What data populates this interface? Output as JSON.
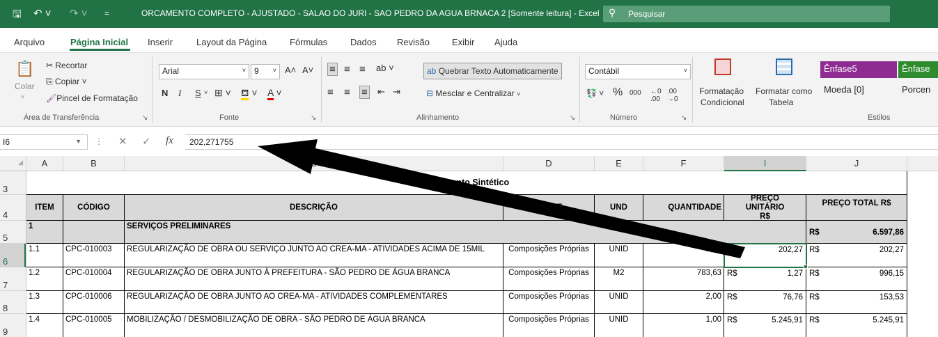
{
  "title_bar": {
    "title": "ORCAMENTO COMPLETO - AJUSTADO - SALAO DO JURI - SAO PEDRO DA AGUA BRNACA  2  [Somente leitura]  -  Excel",
    "search_label": "Pesquisar",
    "save_icon": "save-icon",
    "undo_icon": "undo-icon",
    "redo_icon": "redo-icon",
    "accent_color": "#217346"
  },
  "menu": {
    "items": [
      "Arquivo",
      "Página Inicial",
      "Inserir",
      "Layout da Página",
      "Fórmulas",
      "Dados",
      "Revisão",
      "Exibir",
      "Ajuda"
    ],
    "active": "Página Inicial"
  },
  "ribbon": {
    "clipboard": {
      "paste": "Colar",
      "cut": "Recortar",
      "copy": "Copiar",
      "format_painter": "Pincel de Formatação",
      "label": "Área de Transferência"
    },
    "font": {
      "name": "Arial",
      "size": "9",
      "bold": "N",
      "italic": "I",
      "underline": "S",
      "label": "Fonte"
    },
    "alignment": {
      "wrap_text": "Quebrar Texto Automaticamente",
      "merge_center": "Mesclar e Centralizar",
      "label": "Alinhamento"
    },
    "number": {
      "format": "Contábil",
      "percent": "%",
      "thousands": "000",
      "label": "Número"
    },
    "styles": {
      "conditional": [
        "Formatação",
        "Condicional"
      ],
      "format_table": [
        "Formatar como",
        "Tabela"
      ],
      "cell_styles": [
        "Ênfase5",
        "Ênfase",
        "Moeda [0]",
        "Porcen"
      ],
      "label": "Estilos",
      "emphasis5_color": "#8e2c91",
      "emphasis6_color": "#2e8b2e"
    }
  },
  "formula_bar": {
    "name_box": "I6",
    "fx": "fx",
    "value": "202,271755"
  },
  "columns": [
    "A",
    "B",
    "C",
    "D",
    "E",
    "F",
    "I",
    "J"
  ],
  "selected_column": "I",
  "rows": [
    "3",
    "4",
    "5",
    "6",
    "7",
    "8",
    "9"
  ],
  "selected_row": "6",
  "sheet": {
    "title": "Orçamento Sintético",
    "headers": {
      "item": "ITEM",
      "code": "CÓDIGO",
      "description": "DESCRIÇÃO",
      "source": "FONTE",
      "unit": "UND",
      "quantity": "QUANTIDADE",
      "unit_price": "PREÇO UNITÁRIO R$",
      "total_price": "PREÇO TOTAL R$"
    },
    "section": {
      "item": "1",
      "description": "SERVIÇOS PRELIMINARES",
      "currency": "R$",
      "total": "6.597,86"
    },
    "items": [
      {
        "item": "1.1",
        "code": "CPC-010003",
        "description": "REGULARIZAÇÃO  DE  OBRA  OU  SERVIÇO  JUNTO  AO  CREA-MA  -  ATIVIDADES ACIMA DE 15MIL",
        "source": "Composições Próprias",
        "unit": "UNID",
        "quantity": "1,00",
        "cur1": "R$",
        "unit_price": "202,27",
        "cur2": "R$",
        "total": "202,27"
      },
      {
        "item": "1.2",
        "code": "CPC-010004",
        "description": "REGULARIZAÇÃO DE OBRA JUNTO À PREFEITURA - SÃO PEDRO DE ÁGUA BRANCA",
        "source": "Composições Próprias",
        "unit": "M2",
        "quantity": "783,63",
        "cur1": "R$",
        "unit_price": "1,27",
        "cur2": "R$",
        "total": "996,15"
      },
      {
        "item": "1.3",
        "code": "CPC-010006",
        "description": "REGULARIZAÇÃO  DE  OBRA  JUNTO  AO  CREA-MA  -  ATIVIDADES COMPLEMENTARES",
        "source": "Composições Próprias",
        "unit": "UNID",
        "quantity": "2,00",
        "cur1": "R$",
        "unit_price": "76,76",
        "cur2": "R$",
        "total": "153,53"
      },
      {
        "item": "1.4",
        "code": "CPC-010005",
        "description": "MOBILIZAÇÃO  /  DESMOBILIZAÇÃO DE  OBRA -  SÃO PEDRO  DE ÁGUA BRANCA",
        "source": "Composições Próprias",
        "unit": "UNID",
        "quantity": "1,00",
        "cur1": "R$",
        "unit_price": "5.245,91",
        "cur2": "R$",
        "total": "5.245,91"
      }
    ]
  }
}
